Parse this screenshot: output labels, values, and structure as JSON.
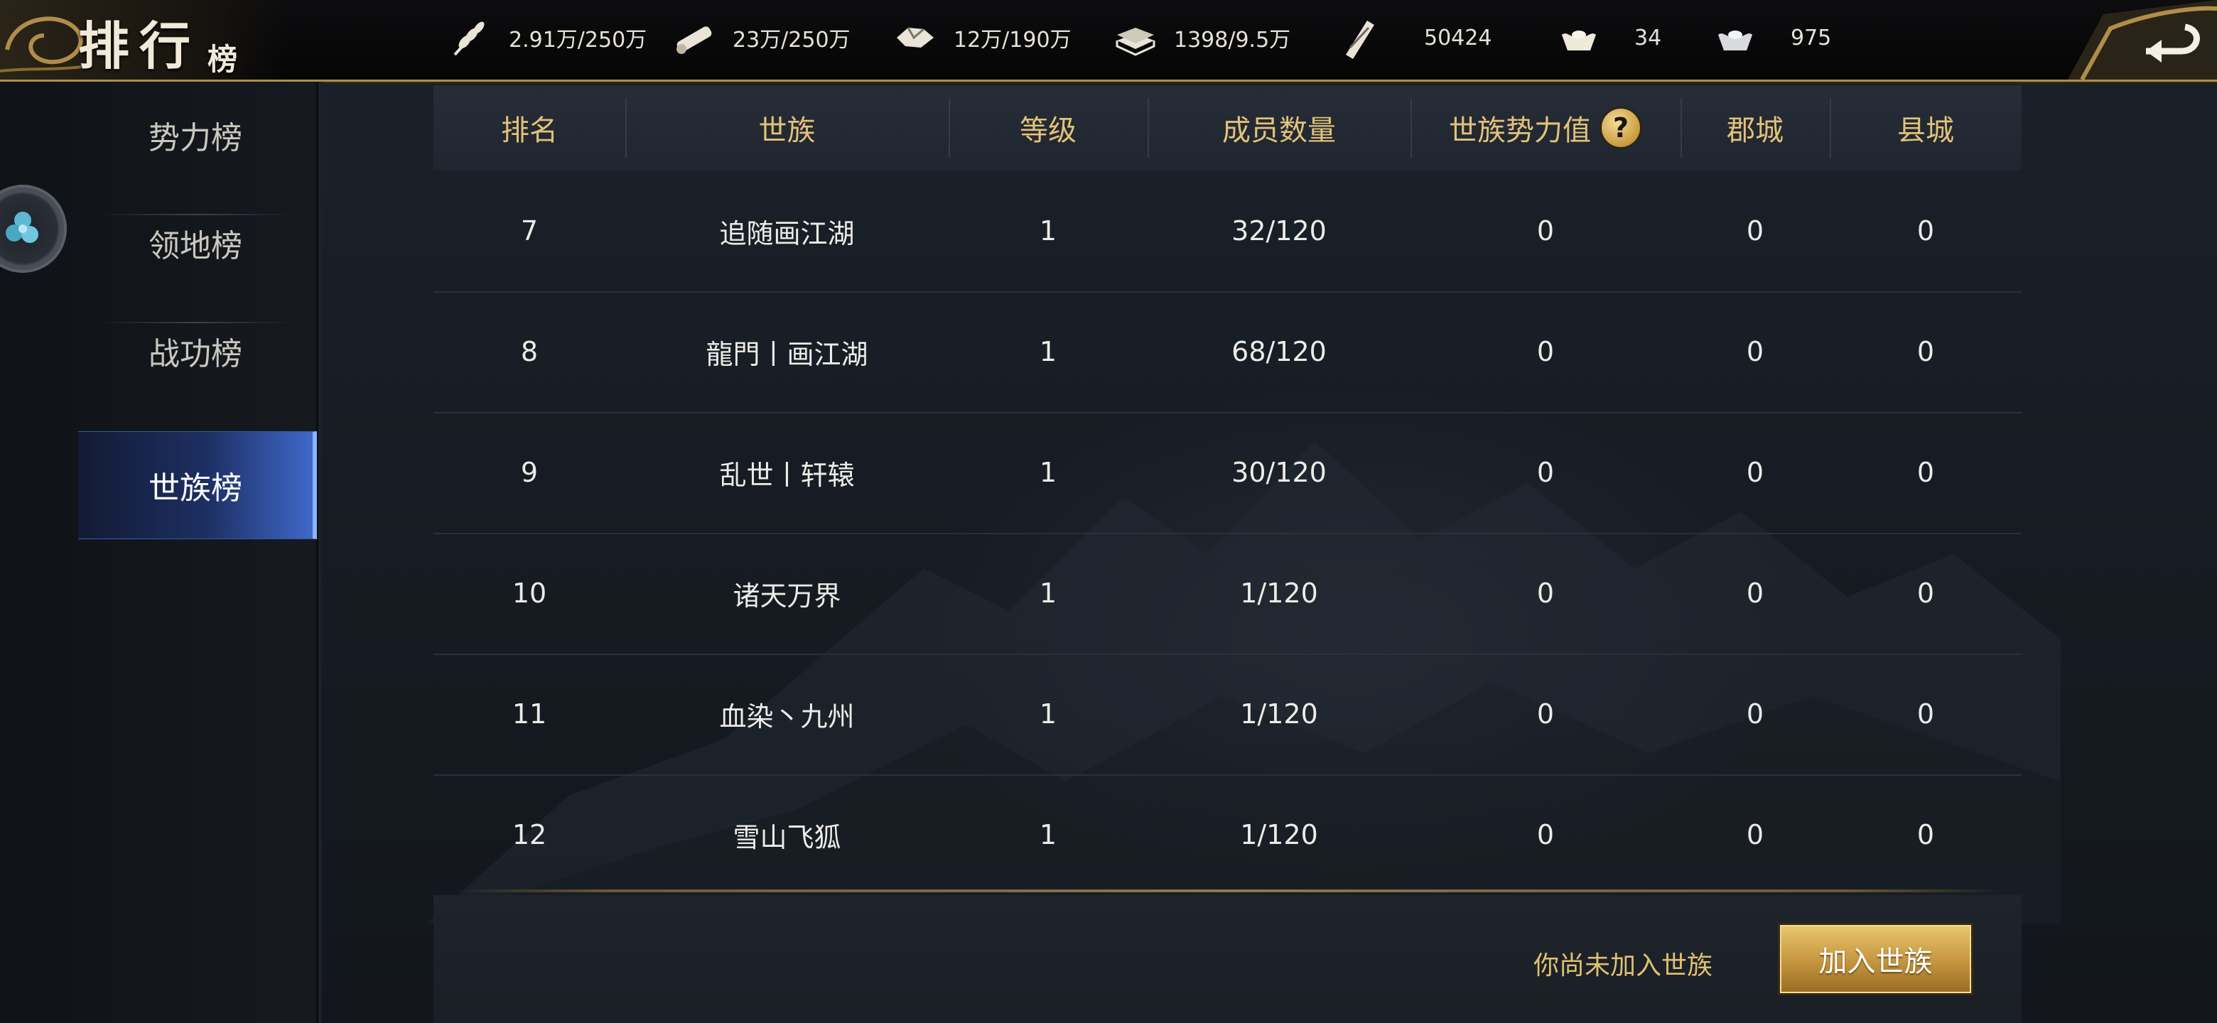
{
  "header": {
    "title": "排行",
    "title_sub": "榜",
    "resources": [
      {
        "icon": "grain-icon",
        "value": "2.91万/250万"
      },
      {
        "icon": "wood-icon",
        "value": "23万/250万"
      },
      {
        "icon": "stone-icon",
        "value": "12万/190万"
      },
      {
        "icon": "iron-icon",
        "value": "1398/9.5万"
      },
      {
        "icon": "decree-icon",
        "value": "50424"
      },
      {
        "icon": "gold-ingot-icon",
        "value": "34"
      },
      {
        "icon": "silver-ingot-icon",
        "value": "975"
      }
    ]
  },
  "sidebar": {
    "items": [
      {
        "label": "势力榜",
        "active": false
      },
      {
        "label": "领地榜",
        "active": false
      },
      {
        "label": "战功榜",
        "active": false
      },
      {
        "label": "世族榜",
        "active": true
      }
    ]
  },
  "table": {
    "headers": [
      "排名",
      "世族",
      "等级",
      "成员数量",
      "世族势力值",
      "郡城",
      "县城"
    ],
    "rows": [
      [
        "7",
        "追随画江湖",
        "1",
        "32/120",
        "0",
        "0",
        "0"
      ],
      [
        "8",
        "龍門丨画江湖",
        "1",
        "68/120",
        "0",
        "0",
        "0"
      ],
      [
        "9",
        "乱世丨轩辕",
        "1",
        "30/120",
        "0",
        "0",
        "0"
      ],
      [
        "10",
        "诸天万界",
        "1",
        "1/120",
        "0",
        "0",
        "0"
      ],
      [
        "11",
        "血染丶九州",
        "1",
        "1/120",
        "0",
        "0",
        "0"
      ],
      [
        "12",
        "雪山飞狐",
        "1",
        "1/120",
        "0",
        "0",
        "0"
      ]
    ]
  },
  "footer": {
    "status": "你尚未加入世族",
    "join_label": "加入世族"
  },
  "colors": {
    "gold": "#e2c27a",
    "active_tab": "#3f68c9",
    "button_gold": "#c4953e"
  }
}
